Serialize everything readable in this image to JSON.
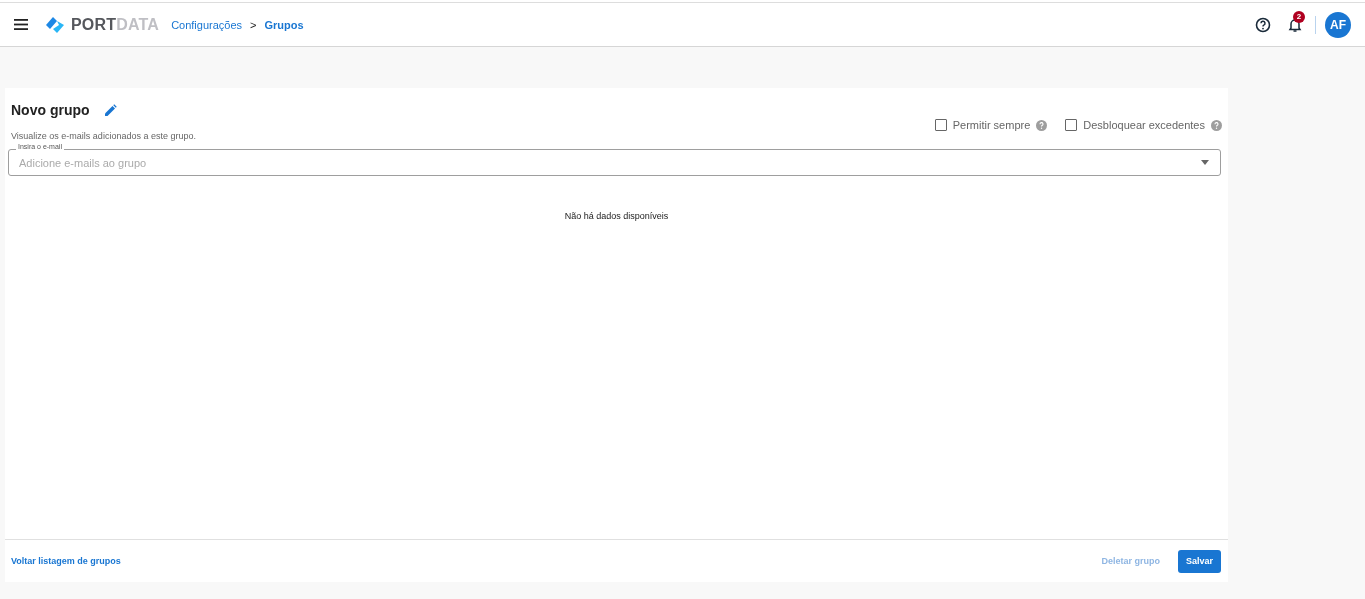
{
  "header": {
    "logo": "**PORT**DATA",
    "breadcrumb": [
      {
        "label": "Configurações",
        "current": false
      },
      {
        "label": ">",
        "kind": "separator"
      },
      {
        "label": "Grupos",
        "current": true
      }
    ],
    "notifications": "2",
    "avatar": "AF"
  },
  "group": {
    "title": "Novo grupo",
    "description": "Visualize os e-mails adicionados a este grupo.",
    "options": [
      {
        "label": "Permitir sempre",
        "checked": false
      },
      {
        "label": "Desbloquear excedentes",
        "checked": false
      }
    ],
    "email_field": {
      "label": "Insira o e-mail",
      "placeholder": "Adicione e-mails ao grupo"
    },
    "empty_message": "Não há dados disponíveis"
  },
  "footer": {
    "back_link": "Voltar listagem de grupos",
    "buttons": [
      {
        "label": "Deletar grupo",
        "disabled": true,
        "kind": "text"
      },
      {
        "label": "Salvar",
        "disabled": false,
        "kind": "primary"
      }
    ]
  }
}
